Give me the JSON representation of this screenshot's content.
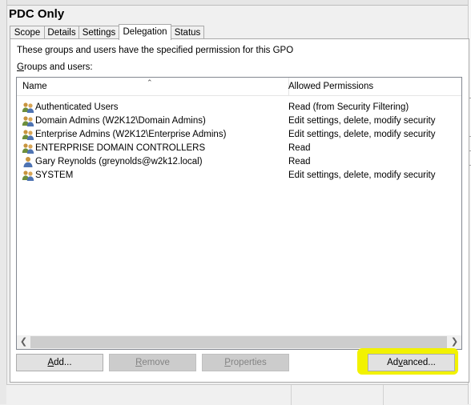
{
  "window": {
    "title": "PDC Only"
  },
  "tabs": [
    {
      "label": "Scope",
      "active": false
    },
    {
      "label": "Details",
      "active": false
    },
    {
      "label": "Settings",
      "active": false
    },
    {
      "label": "Delegation",
      "active": true
    },
    {
      "label": "Status",
      "active": false
    }
  ],
  "delegation": {
    "info_text": "These groups and users have the specified permission for this GPO",
    "groups_label_accel": "G",
    "groups_label_rest": "roups and users:",
    "columns": {
      "name": "Name",
      "permissions": "Allowed Permissions"
    },
    "rows": [
      {
        "name": "Authenticated Users",
        "permission": "Read (from Security Filtering)",
        "icon": "group-icon"
      },
      {
        "name": "Domain Admins (W2K12\\Domain Admins)",
        "permission": "Edit settings, delete, modify security",
        "icon": "group-icon"
      },
      {
        "name": "Enterprise Admins (W2K12\\Enterprise Admins)",
        "permission": "Edit settings, delete, modify security",
        "icon": "group-icon"
      },
      {
        "name": "ENTERPRISE DOMAIN CONTROLLERS",
        "permission": "Read",
        "icon": "group-icon"
      },
      {
        "name": "Gary Reynolds (greynolds@w2k12.local)",
        "permission": "Read",
        "icon": "user-icon"
      },
      {
        "name": "SYSTEM",
        "permission": "Edit settings, delete, modify security",
        "icon": "group-icon"
      }
    ],
    "buttons": {
      "add": {
        "accel": "A",
        "pre": "",
        "post": "dd...",
        "enabled": true
      },
      "remove": {
        "accel": "R",
        "pre": "",
        "post": "emove",
        "enabled": false
      },
      "properties": {
        "accel": "P",
        "pre": "",
        "post": "roperties",
        "enabled": false
      },
      "advanced": {
        "accel": "v",
        "pre": "Ad",
        "post": "anced...",
        "enabled": true
      }
    }
  },
  "colors": {
    "highlight": "#f2f200",
    "selected_tab_bg": "#ffffff",
    "disabled_text": "#838383"
  }
}
